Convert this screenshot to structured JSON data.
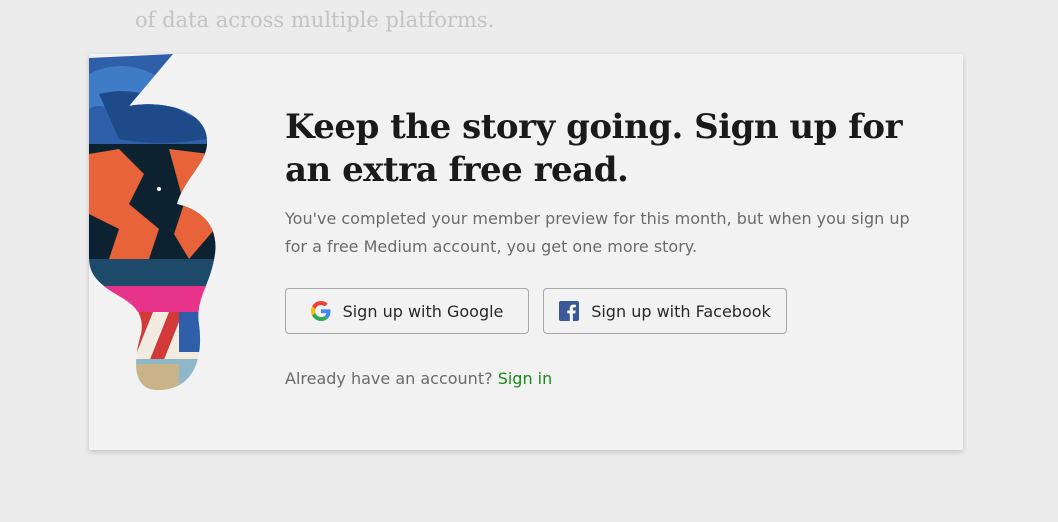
{
  "background": {
    "partial_text": "of data across multiple platforms."
  },
  "modal": {
    "headline": "Keep the story going. Sign up for an extra free read.",
    "subtext": "You've completed your member preview for this month, but when you sign up for a free Medium account, you get one more story.",
    "google_button": {
      "label": "Sign up with Google",
      "icon": "google-icon"
    },
    "facebook_button": {
      "label": "Sign up with Facebook",
      "icon": "facebook-icon"
    },
    "signin_prompt": "Already have an account?",
    "signin_link": "Sign in"
  },
  "colors": {
    "page_bg": "#ececec",
    "modal_bg": "#f2f2f2",
    "headline": "#1a1a1a",
    "body_text": "#6b6b6b",
    "link_green": "#1a8917",
    "facebook_blue": "#3b5998"
  }
}
